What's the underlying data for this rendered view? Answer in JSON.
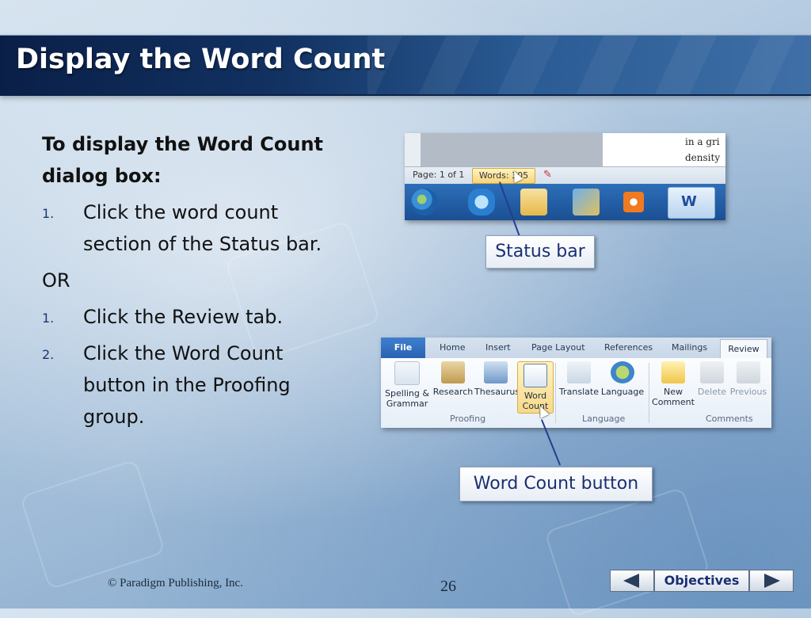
{
  "title": "Display the Word Count",
  "intro": "To display the Word Count dialog box:",
  "method1": [
    {
      "num": "1.",
      "text": "Click the word count section of the Status bar."
    }
  ],
  "or_label": "OR",
  "method2": [
    {
      "num": "1.",
      "text": "Click the Review tab."
    },
    {
      "num": "2.",
      "text": "Click the Word Count button in the Proofing group."
    }
  ],
  "statusbar_shot": {
    "doc_line1": "in a gri",
    "doc_line2": "density",
    "page_label": "Page: 1 of 1",
    "words_label": "Words: 305"
  },
  "ribbon_shot": {
    "tabs": [
      "File",
      "Home",
      "Insert",
      "Page Layout",
      "References",
      "Mailings",
      "Review"
    ],
    "buttons": {
      "spelling": "Spelling & Grammar",
      "research": "Research",
      "thesaurus": "Thesaurus",
      "word_count": "Word Count",
      "translate": "Translate",
      "language": "Language",
      "new_comment": "New Comment",
      "delete": "Delete",
      "previous": "Previous"
    },
    "groups": {
      "proofing": "Proofing",
      "language": "Language",
      "comments": "Comments"
    }
  },
  "callouts": {
    "status_bar": "Status bar",
    "word_count_button": "Word Count button"
  },
  "footer": {
    "copyright": "© Paradigm Publishing, Inc.",
    "page_number": "26",
    "objectives": "Objectives"
  },
  "colors": {
    "title_bg": "#123262",
    "callout_text": "#1a2f73",
    "highlight": "#f7d98a"
  }
}
